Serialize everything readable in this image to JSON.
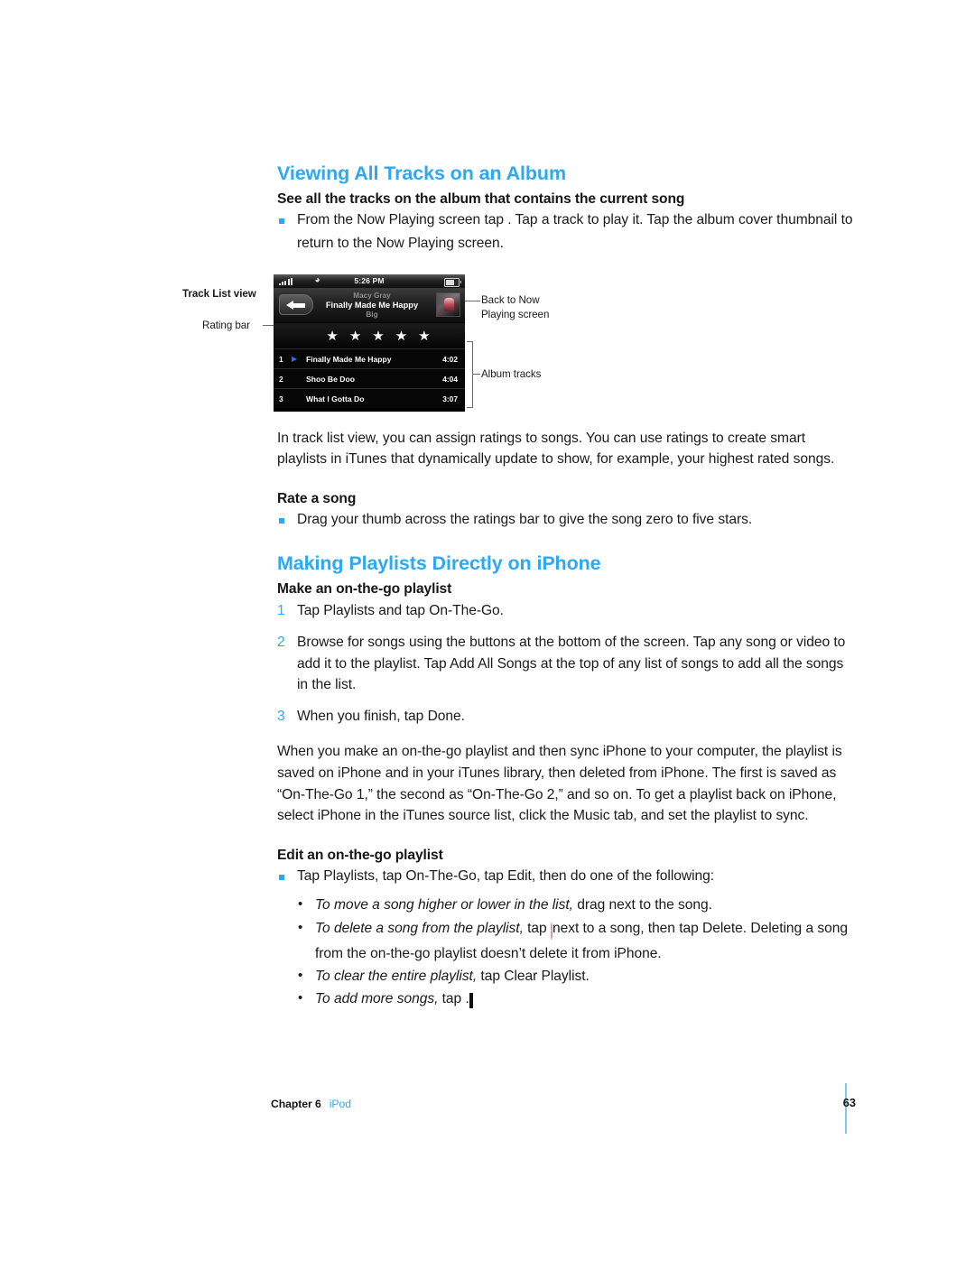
{
  "document": {
    "chapter_label": "Chapter 6",
    "chapter_link": "iPod",
    "page_number": "63",
    "accent_color": "#2BA9F4"
  },
  "section1": {
    "title": "Viewing All Tracks on an Album",
    "subhead": "See all the tracks on the album that contains the current song",
    "bullet": {
      "part1": "From the Now Playing screen tap ",
      "icon": "tracklist-icon",
      "part2": ". Tap a track to play it. Tap the album cover thumbnail to return to the Now Playing screen."
    },
    "paragraph": "In track list view, you can assign ratings to songs. You can use ratings to create smart playlists in iTunes that dynamically update to show, for example, your highest rated songs.",
    "rate_subhead": "Rate a song",
    "rate_bullet": "Drag your thumb across the ratings bar to give the song zero to five stars."
  },
  "figure": {
    "callouts": {
      "track_list_view": "Track List view",
      "rating_bar": "Rating bar",
      "back_to_now_line1": "Back to Now",
      "back_to_now_line2": "Playing screen",
      "album_tracks": "Album tracks"
    },
    "phone": {
      "status": {
        "signal_icon": "cellular-signal-icon",
        "wifi_icon": "wifi-icon",
        "time": "5:26 PM",
        "battery_icon": "battery-icon"
      },
      "nav": {
        "back_icon": "back-arrow-icon",
        "artist": "Macy Gray",
        "song": "Finally Made Me Happy",
        "album": "Big",
        "album_art": "album-art-thumbnail"
      },
      "rating": {
        "stars": [
          "★",
          "★",
          "★",
          "★",
          "★"
        ],
        "filled_count": 5
      },
      "tracks": [
        {
          "num": "1",
          "playing": true,
          "title": "Finally Made Me Happy",
          "time": "4:02"
        },
        {
          "num": "2",
          "playing": false,
          "title": "Shoo Be Doo",
          "time": "4:04"
        },
        {
          "num": "3",
          "playing": false,
          "title": "What I Gotta Do",
          "time": "3:07"
        }
      ]
    }
  },
  "section2": {
    "title": "Making Playlists Directly on iPhone",
    "subhead": "Make an on-the-go playlist",
    "steps": [
      {
        "num": "1",
        "text": "Tap Playlists and tap On-The-Go."
      },
      {
        "num": "2",
        "text": "Browse for songs using the buttons at the bottom of the screen. Tap any song or video to add it to the playlist. Tap Add All Songs at the top of any list of songs to add all the songs in the list."
      },
      {
        "num": "3",
        "text": "When you finish, tap Done."
      }
    ],
    "paragraph": "When you make an on-the-go playlist and then sync iPhone to your computer, the playlist is saved on iPhone and in your iTunes library, then deleted from iPhone. The first is saved as “On-The-Go 1,” the second as “On-The-Go 2,” and so on. To get a playlist back on iPhone, select iPhone in the iTunes source list, click the Music tab, and set the playlist to sync.",
    "edit_subhead": "Edit an on-the-go playlist",
    "edit_bullet": "Tap Playlists, tap On-The-Go, tap Edit, then do one of the following:",
    "sub_bullets": [
      {
        "italic": "To move a song higher or lower in the list,",
        "before_icon": " drag ",
        "icon": "drag-handle-icon",
        "after_icon": " next to the song."
      },
      {
        "italic": "To delete a song from the playlist,",
        "before_icon": " tap ",
        "icon": "delete-minus-icon",
        "after_icon": " next to a song, then tap Delete. Deleting a song from the on-the-go playlist doesn’t delete it from iPhone."
      },
      {
        "italic": "To clear the entire playlist,",
        "before_icon": " tap Clear Playlist.",
        "icon": null,
        "after_icon": ""
      },
      {
        "italic": "To add more songs,",
        "before_icon": " tap ",
        "icon": "plus-icon",
        "after_icon": "."
      }
    ]
  }
}
